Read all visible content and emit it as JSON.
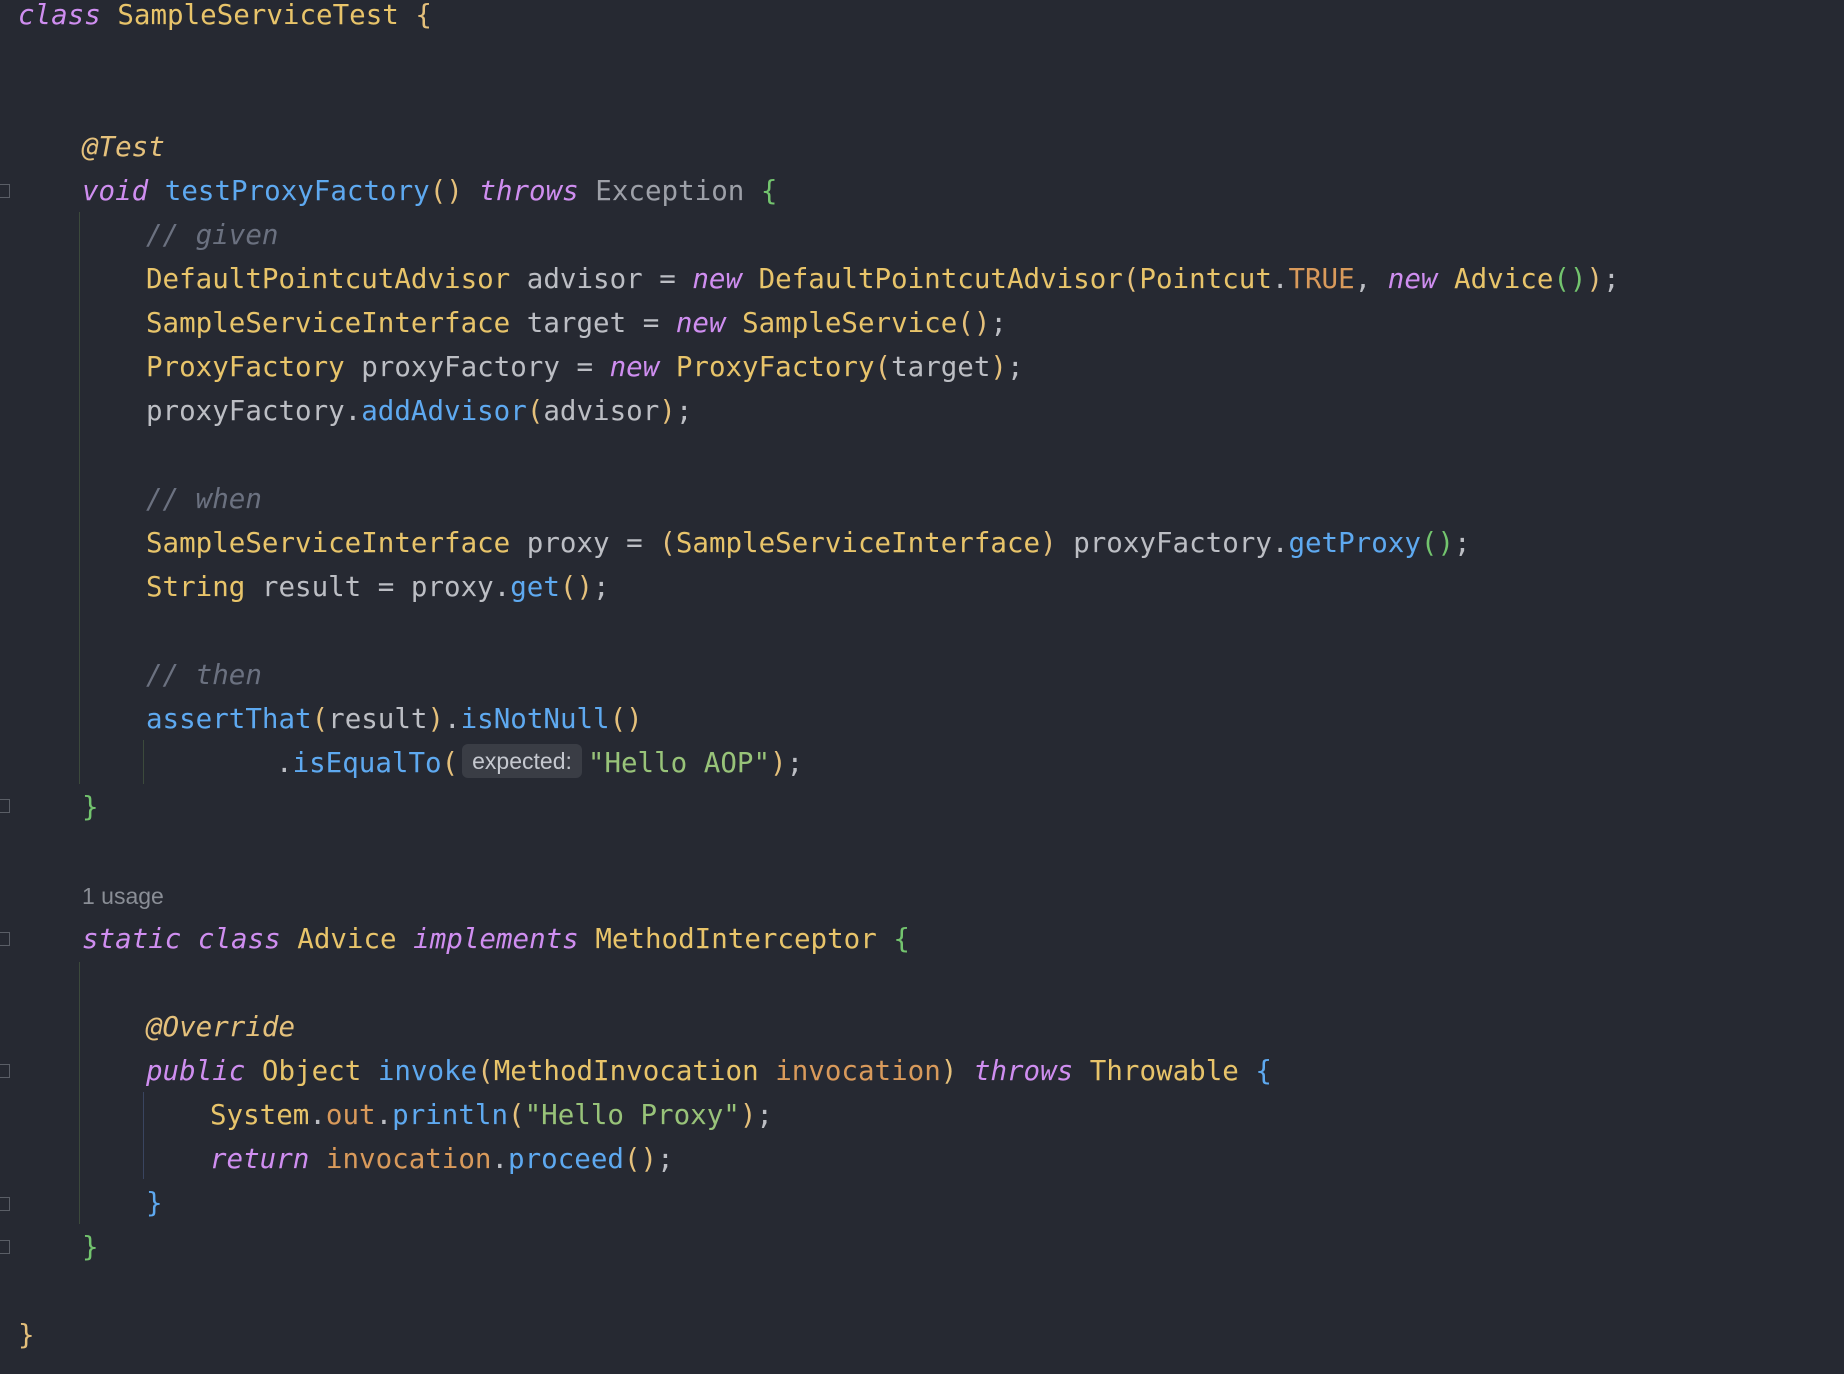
{
  "code": {
    "class_header": {
      "kw": "class",
      "name": "SampleServiceTest",
      "brace": "{"
    },
    "test_annotation": "@Test",
    "method_sig": {
      "kw": "void",
      "name": "testProxyFactory",
      "parens": "()",
      "throws": "throws",
      "exception": "Exception",
      "brace": "{"
    },
    "cmt_given": "// given",
    "line_advisor": {
      "type": "DefaultPointcutAdvisor",
      "var": " advisor = ",
      "new1": "new",
      "ctor": "DefaultPointcutAdvisor",
      "open": "(",
      "arg_cls": "Pointcut",
      "dot": ".",
      "const": "TRUE",
      "comma": ", ",
      "new2": "new",
      "inner": "Advice",
      "inner_parens": "()",
      "close": ")",
      "semi": ";"
    },
    "line_target": {
      "type": "SampleServiceInterface",
      "var": " target = ",
      "new": "new",
      "ctor": "SampleService",
      "parens": "()",
      "semi": ";"
    },
    "line_factory": {
      "type": "ProxyFactory",
      "var": " proxyFactory = ",
      "new": "new",
      "ctor": "ProxyFactory",
      "open": "(",
      "arg": "target",
      "close": ")",
      "semi": ";"
    },
    "line_add": {
      "obj": "proxyFactory.",
      "fn": "addAdvisor",
      "open": "(",
      "arg": "advisor",
      "close": ")",
      "semi": ";"
    },
    "cmt_when": "// when",
    "line_proxy": {
      "type": "SampleServiceInterface",
      "var": " proxy = ",
      "open": "(",
      "cast": "SampleServiceInterface",
      "close": ")",
      "obj": " proxyFactory.",
      "fn": "getProxy",
      "parens": "()",
      "semi": ";"
    },
    "line_result": {
      "type": "String",
      "var": " result = proxy.",
      "fn": "get",
      "parens": "()",
      "semi": ";"
    },
    "cmt_then": "// then",
    "line_assert": {
      "fn": "assertThat",
      "open": "(",
      "arg": "result",
      "close": ")",
      "dot": ".",
      "fn2": "isNotNull",
      "parens": "()"
    },
    "line_equal": {
      "dot": ".",
      "fn": "isEqualTo",
      "open": "(",
      "hint": "expected:",
      "str": "\"Hello AOP\"",
      "close": ")",
      "semi": ";"
    },
    "method_close": "}",
    "usage_lens": "1 usage",
    "inner_class": {
      "kw1": "static",
      "kw2": "class",
      "name": "Advice",
      "kw3": "implements",
      "iface": "MethodInterceptor",
      "brace": "{"
    },
    "override_annotation": "@Override",
    "invoke_sig": {
      "kw": "public",
      "ret": "Object",
      "fn": "invoke",
      "open": "(",
      "ptype": "MethodInvocation",
      "pname": "invocation",
      "close": ")",
      "throws": "throws",
      "exc": "Throwable",
      "brace": "{"
    },
    "line_println": {
      "cls": "System",
      "dot1": ".",
      "field": "out",
      "dot2": ".",
      "fn": "println",
      "open": "(",
      "str": "\"Hello Proxy\"",
      "close": ")",
      "semi": ";"
    },
    "line_return": {
      "kw": "return",
      "obj": "invocation",
      "dot": ".",
      "fn": "proceed",
      "parens": "()",
      "semi": ";"
    },
    "invoke_close": "}",
    "inner_close": "}",
    "class_close": "}"
  },
  "colors": {
    "background": "#262932",
    "keyword": "#CF8EF0",
    "class": "#E8C46A",
    "function": "#5EA9F0",
    "comment": "#6B7180",
    "string": "#98C379",
    "constant": "#D99A5B"
  }
}
